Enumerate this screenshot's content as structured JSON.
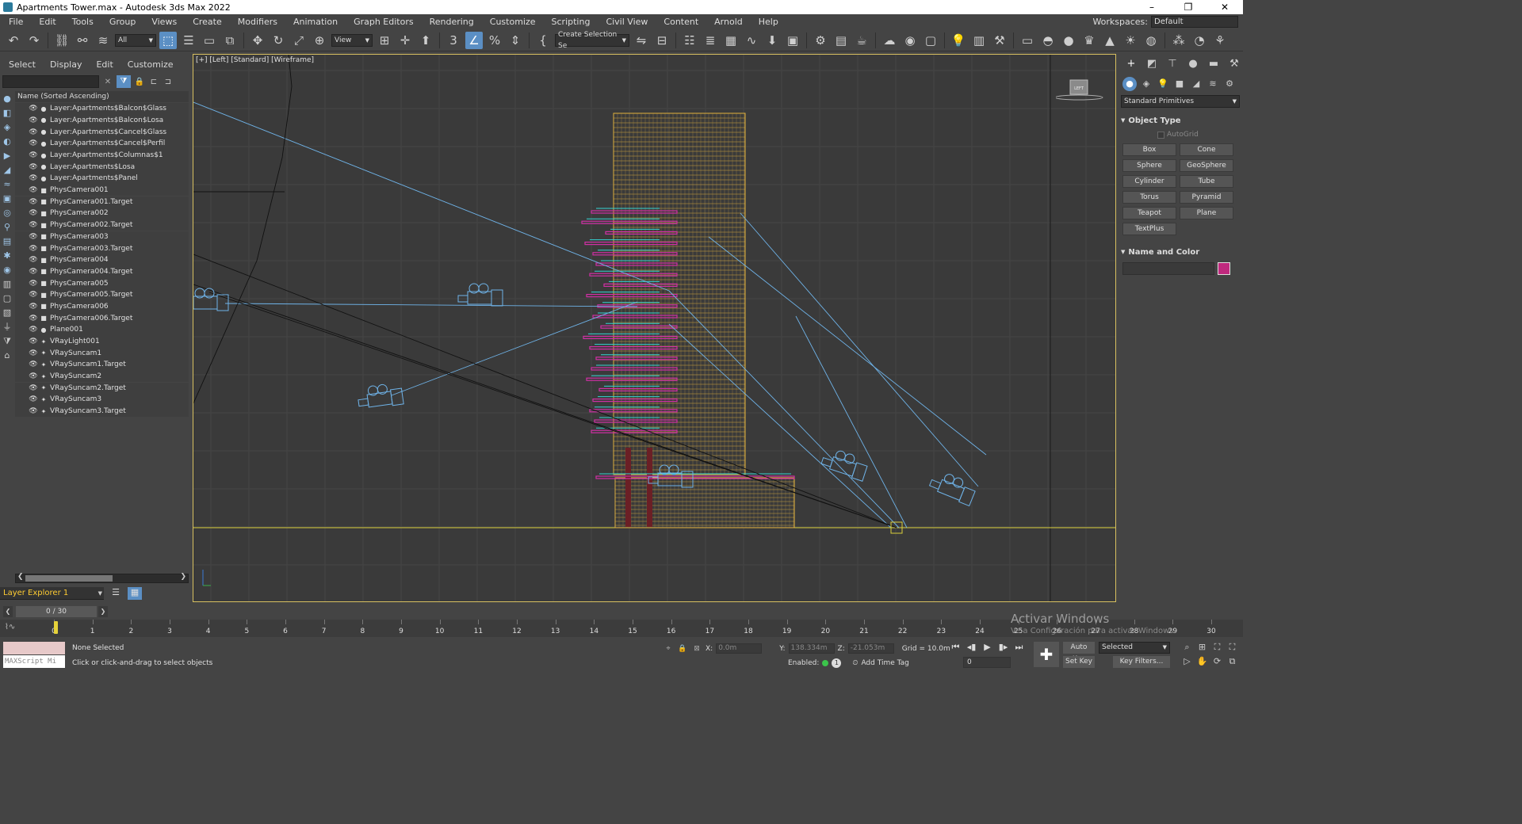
{
  "window": {
    "title": "Apartments Tower.max - Autodesk 3ds Max 2022",
    "minimize": "–",
    "maximize": "❐",
    "close": "✕"
  },
  "menu": [
    "File",
    "Edit",
    "Tools",
    "Group",
    "Views",
    "Create",
    "Modifiers",
    "Animation",
    "Graph Editors",
    "Rendering",
    "Customize",
    "Scripting",
    "Civil View",
    "Content",
    "Arnold",
    "Help"
  ],
  "workspace": {
    "label": "Workspaces:",
    "value": "Default"
  },
  "toolbar": {
    "selection_filter": "All",
    "ref_coord": "View",
    "named_selection": "Create Selection Se"
  },
  "explorer": {
    "tabs": [
      "Select",
      "Display",
      "Edit",
      "Customize"
    ],
    "search_value": "",
    "column_header": "Name (Sorted Ascending)",
    "items": [
      {
        "name": "Layer:Apartments$Balcon$Glass",
        "type": "layer"
      },
      {
        "name": "Layer:Apartments$Balcon$Losa",
        "type": "layer"
      },
      {
        "name": "Layer:Apartments$Cancel$Glass",
        "type": "layer"
      },
      {
        "name": "Layer:Apartments$Cancel$Perfil",
        "type": "layer"
      },
      {
        "name": "Layer:Apartments$Columnas$1",
        "type": "layer"
      },
      {
        "name": "Layer:Apartments$Losa",
        "type": "layer"
      },
      {
        "name": "Layer:Apartments$Panel",
        "type": "layer"
      },
      {
        "name": "PhysCamera001",
        "type": "camera"
      },
      {
        "name": "PhysCamera001.Target",
        "type": "camera"
      },
      {
        "name": "PhysCamera002",
        "type": "camera"
      },
      {
        "name": "PhysCamera002.Target",
        "type": "camera"
      },
      {
        "name": "PhysCamera003",
        "type": "camera"
      },
      {
        "name": "PhysCamera003.Target",
        "type": "camera"
      },
      {
        "name": "PhysCamera004",
        "type": "camera"
      },
      {
        "name": "PhysCamera004.Target",
        "type": "camera"
      },
      {
        "name": "PhysCamera005",
        "type": "camera"
      },
      {
        "name": "PhysCamera005.Target",
        "type": "camera"
      },
      {
        "name": "PhysCamera006",
        "type": "camera"
      },
      {
        "name": "PhysCamera006.Target",
        "type": "camera"
      },
      {
        "name": "Plane001",
        "type": "geometry"
      },
      {
        "name": "VRayLight001",
        "type": "light"
      },
      {
        "name": "VRaySuncam1",
        "type": "light"
      },
      {
        "name": "VRaySuncam1.Target",
        "type": "light"
      },
      {
        "name": "VRaySuncam2",
        "type": "light"
      },
      {
        "name": "VRaySuncam2.Target",
        "type": "light"
      },
      {
        "name": "VRaySuncam3",
        "type": "light"
      },
      {
        "name": "VRaySuncam3.Target",
        "type": "light"
      }
    ],
    "layer_explorer": "Layer Explorer 1"
  },
  "viewport": {
    "label": "[+] [Left] [Standard] [Wireframe]",
    "viewcube_label": "LEFT",
    "colors": {
      "building": "#e3b23c",
      "balcony_magenta": "#d12fa5",
      "balcony_cyan": "#35d3d3",
      "camera": "#6fb3e8",
      "ground": "#d9cf3a"
    }
  },
  "command_panel": {
    "category": "Standard Primitives",
    "object_type_title": "Object Type",
    "autogrid": "AutoGrid",
    "primitives": [
      "Box",
      "Cone",
      "Sphere",
      "GeoSphere",
      "Cylinder",
      "Tube",
      "Torus",
      "Pyramid",
      "Teapot",
      "Plane",
      "TextPlus"
    ],
    "name_color_title": "Name and Color",
    "object_color": "#c0297e"
  },
  "time": {
    "frame_display": "0 / 30",
    "ticks": [
      0,
      1,
      2,
      3,
      4,
      5,
      6,
      7,
      8,
      9,
      10,
      11,
      12,
      13,
      14,
      15,
      16,
      17,
      18,
      19,
      20,
      21,
      22,
      23,
      24,
      25,
      26,
      27,
      28,
      29,
      30
    ]
  },
  "status": {
    "maxscript_placeholder": "MAXScript Mi",
    "selection": "None Selected",
    "prompt": "Click or click-and-drag to select objects",
    "x_label": "X:",
    "x_value": "0.0m",
    "y_label": "Y:",
    "y_value": "138.334m",
    "z_label": "Z:",
    "z_value": "-21.053m",
    "grid": "Grid = 10.0m",
    "enabled": "Enabled:",
    "enabled_count": "1",
    "add_time_tag": "Add Time Tag",
    "current_frame": "0",
    "auto_key": "Auto Key",
    "set_key": "Set Key",
    "selected_set": "Selected",
    "key_filters": "Key Filters..."
  },
  "watermark": {
    "title": "Activar Windows",
    "subtitle": "Ve a Configuración para activar Windows."
  }
}
